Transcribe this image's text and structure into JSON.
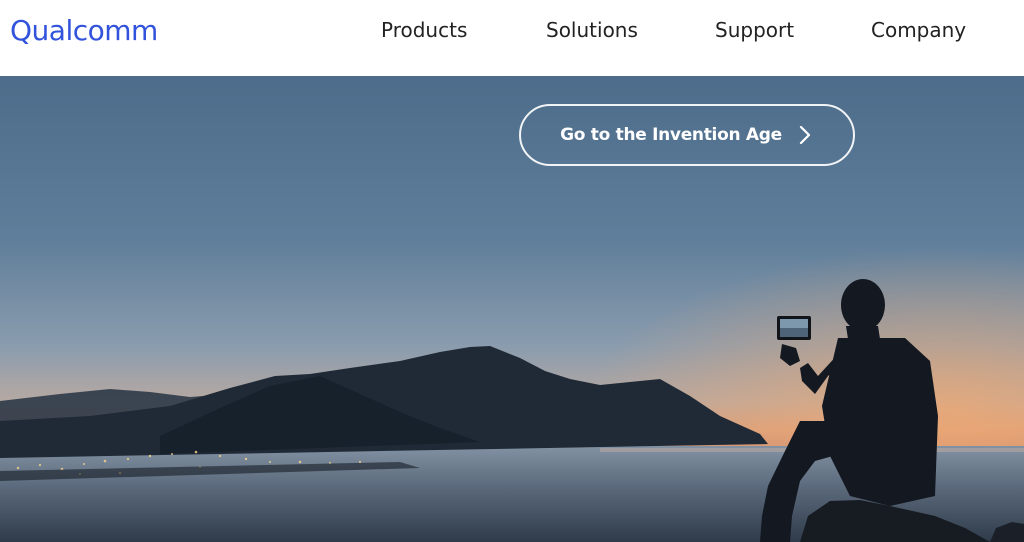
{
  "header": {
    "logo_text": "Qualcomm",
    "brand_color": "#3253dc",
    "nav": {
      "products": "Products",
      "solutions": "Solutions",
      "support": "Support",
      "company": "Company"
    }
  },
  "hero": {
    "cta_label": "Go to the Invention Age",
    "cta_icon": "chevron-right-icon",
    "scene": "sunset-coast-person-holding-tablet"
  }
}
